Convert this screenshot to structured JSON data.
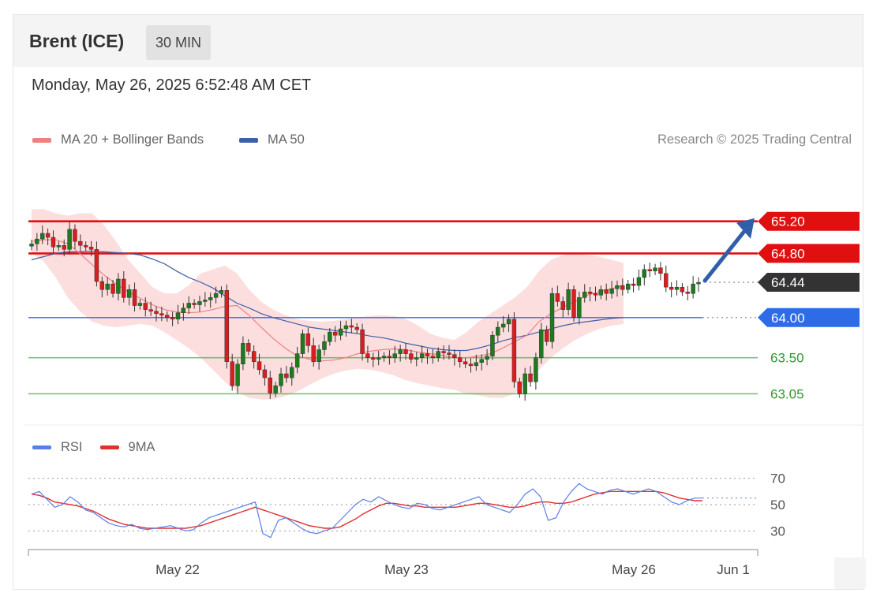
{
  "header": {
    "instrument": "Brent (ICE)",
    "timeframe": "30 MIN",
    "timestamp": "Monday, May 26, 2025 6:52:48 AM CET"
  },
  "legend": {
    "ma20_label": "MA 20 + Bollinger Bands",
    "ma50_label": "MA 50",
    "credit": "Research © 2025 Trading Central"
  },
  "rsi_legend": {
    "rsi_label": "RSI",
    "ma9_label": "9MA"
  },
  "colors": {
    "up": "#1f7a1f",
    "down": "#d81e1e",
    "band_fill": "#fbd3d3",
    "ma20": "#f08080",
    "ma50": "#3f5fa8",
    "resistance": "#e01010",
    "support_blue": "#2e6be6",
    "support_green": "#4caf50",
    "current": "#333333",
    "rsi": "#5b7fe8",
    "rsi_ma": "#e03030",
    "arrow": "#2f5fa8"
  },
  "chart_data": {
    "type": "candlestick",
    "price_range": [
      62.75,
      65.6
    ],
    "x_ticks": [
      "May 22",
      "May 23",
      "May 26",
      "Jun 1"
    ],
    "levels": [
      {
        "name": "resistance-2",
        "value": 65.2,
        "label": "65.20",
        "style": "resistance"
      },
      {
        "name": "resistance-1",
        "value": 64.8,
        "label": "64.80",
        "style": "resistance"
      },
      {
        "name": "current",
        "value": 64.44,
        "label": "64.44",
        "style": "current"
      },
      {
        "name": "pivot",
        "value": 64.0,
        "label": "64.00",
        "style": "pivot"
      },
      {
        "name": "support-1",
        "value": 63.5,
        "label": "63.50",
        "style": "support"
      },
      {
        "name": "support-2",
        "value": 63.05,
        "label": "63.05",
        "style": "support"
      }
    ],
    "closes": [
      64.92,
      64.98,
      65.05,
      65.0,
      64.88,
      64.9,
      64.85,
      65.1,
      64.95,
      64.9,
      64.88,
      64.85,
      64.45,
      64.35,
      64.42,
      64.3,
      64.48,
      64.25,
      64.35,
      64.15,
      64.18,
      64.1,
      64.08,
      64.05,
      64.03,
      64.0,
      63.98,
      64.06,
      64.12,
      64.18,
      64.16,
      64.2,
      64.22,
      64.25,
      64.3,
      64.34,
      63.45,
      63.15,
      63.42,
      63.68,
      63.58,
      63.45,
      63.35,
      63.25,
      63.06,
      63.15,
      63.3,
      63.25,
      63.38,
      63.55,
      63.8,
      63.65,
      63.45,
      63.6,
      63.7,
      63.82,
      63.78,
      63.86,
      63.9,
      63.88,
      63.85,
      63.55,
      63.5,
      63.48,
      63.5,
      63.52,
      63.5,
      63.55,
      63.6,
      63.55,
      63.48,
      63.5,
      63.55,
      63.52,
      63.5,
      63.58,
      63.56,
      63.54,
      63.5,
      63.45,
      63.42,
      63.4,
      63.44,
      63.48,
      63.52,
      63.78,
      63.88,
      63.92,
      63.98,
      63.2,
      63.05,
      63.3,
      63.2,
      63.5,
      63.85,
      63.7,
      64.3,
      64.2,
      64.1,
      64.35,
      64.0,
      64.25,
      64.32,
      64.3,
      64.28,
      64.35,
      64.3,
      64.36,
      64.4,
      64.35,
      64.42,
      64.4,
      64.5,
      64.6,
      64.58,
      64.62,
      64.55,
      64.38,
      64.35,
      64.38,
      64.32,
      64.3,
      64.42,
      64.44
    ],
    "ma20": [
      64.95,
      64.97,
      64.97,
      64.92,
      64.8,
      64.66,
      64.53,
      64.42,
      64.32,
      64.24,
      64.16,
      64.1,
      64.07,
      64.06,
      64.07,
      64.1,
      64.14,
      64.15,
      64.03,
      63.88,
      63.74,
      63.62,
      63.52,
      63.48,
      63.46,
      63.47,
      63.5,
      63.55,
      63.58,
      63.6,
      63.61,
      63.6,
      63.57,
      63.55,
      63.53,
      63.5,
      63.5,
      63.52,
      63.55,
      63.62,
      63.7,
      63.78,
      63.95,
      64.05,
      64.13,
      64.2,
      64.28,
      64.32,
      64.36,
      64.4
    ],
    "ma50": [
      64.72,
      64.76,
      64.8,
      64.82,
      64.82,
      64.83,
      64.82,
      64.81,
      64.8,
      64.78,
      64.73,
      64.67,
      64.58,
      64.5,
      64.44,
      64.37,
      64.27,
      64.18,
      64.12,
      64.05,
      64.0,
      63.96,
      63.92,
      63.88,
      63.86,
      63.84,
      63.82,
      63.8,
      63.77,
      63.75,
      63.72,
      63.68,
      63.65,
      63.62,
      63.6,
      63.59,
      63.59,
      63.62,
      63.66,
      63.71,
      63.75,
      63.78,
      63.82,
      63.86,
      63.9,
      63.93,
      63.95,
      63.97,
      63.99,
      64.0
    ],
    "band_upper": [
      65.35,
      65.35,
      65.3,
      65.27,
      65.3,
      65.3,
      65.15,
      64.95,
      64.72,
      64.55,
      64.38,
      64.3,
      64.3,
      64.4,
      64.55,
      64.6,
      64.65,
      64.55,
      64.35,
      64.2,
      64.1,
      64.03,
      63.98,
      63.96,
      63.95,
      63.96,
      63.98,
      64.0,
      64.02,
      64.03,
      64.02,
      63.98,
      63.9,
      63.8,
      63.75,
      63.72,
      63.82,
      63.95,
      64.05,
      64.15,
      64.25,
      64.38,
      64.58,
      64.72,
      64.78,
      64.8,
      64.78,
      64.76,
      64.72,
      64.68
    ],
    "band_lower": [
      64.8,
      64.7,
      64.5,
      64.25,
      64.08,
      63.95,
      63.9,
      63.88,
      63.9,
      63.92,
      63.9,
      63.82,
      63.72,
      63.62,
      63.5,
      63.35,
      63.2,
      63.08,
      63.0,
      62.98,
      62.98,
      63.02,
      63.08,
      63.16,
      63.24,
      63.3,
      63.34,
      63.36,
      63.35,
      63.32,
      63.28,
      63.22,
      63.18,
      63.15,
      63.12,
      63.1,
      63.05,
      63.03,
      63.0,
      63.0,
      63.05,
      63.2,
      63.35,
      63.5,
      63.62,
      63.72,
      63.8,
      63.86,
      63.9,
      63.92
    ],
    "rsi": {
      "range": [
        20,
        80
      ],
      "levels": [
        70,
        50,
        30
      ],
      "rsi_values": [
        58,
        60,
        54,
        48,
        50,
        56,
        52,
        46,
        44,
        40,
        36,
        34,
        33,
        35,
        32,
        31,
        32,
        33,
        34,
        32,
        30,
        31,
        36,
        40,
        42,
        44,
        46,
        48,
        50,
        52,
        28,
        25,
        38,
        40,
        36,
        32,
        29,
        28,
        30,
        32,
        38,
        44,
        50,
        54,
        52,
        56,
        53,
        50,
        48,
        47,
        51,
        50,
        47,
        46,
        48,
        50,
        52,
        54,
        56,
        50,
        48,
        46,
        44,
        50,
        58,
        62,
        56,
        38,
        40,
        52,
        60,
        66,
        62,
        60,
        58,
        61,
        62,
        60,
        58,
        60,
        62,
        60,
        56,
        52,
        50,
        53,
        55,
        55
      ],
      "ma9_values": [
        58,
        57,
        55,
        52,
        51,
        50,
        49,
        47,
        45,
        42,
        39,
        37,
        35,
        34,
        33,
        32,
        32,
        32,
        32,
        32,
        32,
        33,
        34,
        36,
        38,
        40,
        42,
        44,
        46,
        48,
        46,
        44,
        42,
        40,
        38,
        36,
        34,
        33,
        32,
        32,
        33,
        36,
        39,
        43,
        46,
        49,
        51,
        51,
        50,
        49,
        49,
        48,
        48,
        48,
        48,
        48,
        49,
        50,
        51,
        51,
        50,
        49,
        48,
        48,
        49,
        51,
        52,
        52,
        51,
        51,
        52,
        54,
        56,
        58,
        59,
        60,
        60,
        60,
        60,
        60,
        60,
        60,
        59,
        57,
        55,
        54,
        53,
        53
      ]
    }
  }
}
